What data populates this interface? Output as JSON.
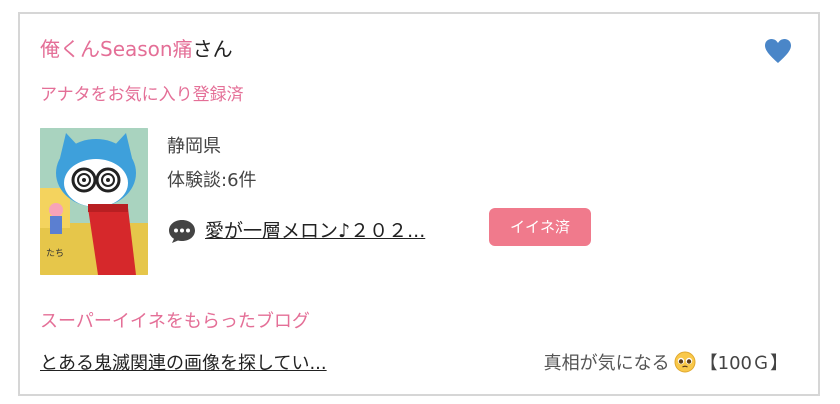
{
  "user": {
    "name": "俺くんSeason痛",
    "suffix": "さん",
    "favorite_status": "アナタをお気に入り登録済"
  },
  "profile": {
    "prefecture": "静岡県",
    "review_count": "体験談:6件"
  },
  "blog": {
    "title": "愛が一層メロン♪２０２...",
    "iine_label": "イイネ済"
  },
  "super_iine": {
    "heading": "スーパーイイネをもらったブログ",
    "blog_title": "とある鬼滅関連の画像を探してい...",
    "comment": "真相が気になる",
    "price": "【100Ｇ】"
  },
  "icons": {
    "favorite": "heart-icon",
    "comment": "speech-bubble-icon",
    "emoji": "pleading-face-emoji"
  },
  "colors": {
    "accent_pink": "#e46f97",
    "button_pink": "#f07a8c",
    "heart_blue": "#4a86c8",
    "border": "#d6d6d6"
  }
}
